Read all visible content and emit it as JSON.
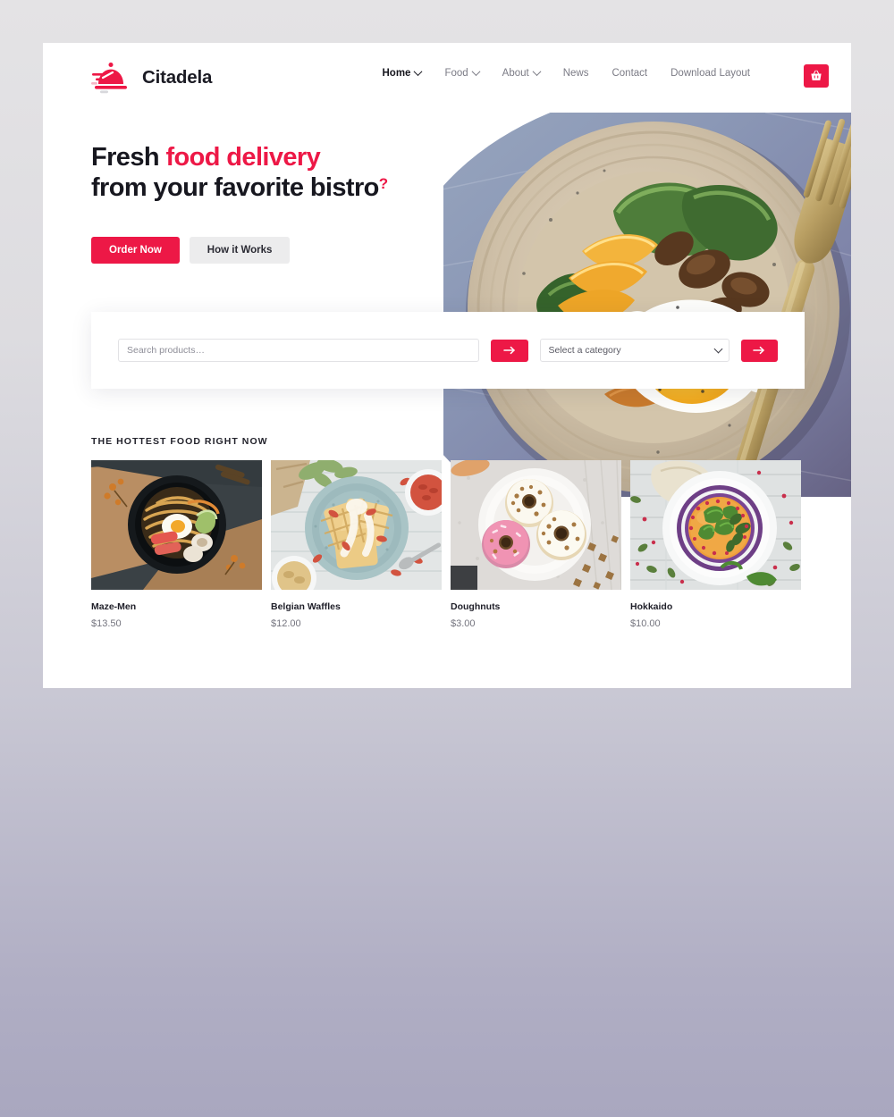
{
  "theme": {
    "accent": "#ed1846",
    "text_dark": "#17171f",
    "text_muted": "#7b7b85",
    "card_bg": "#ffffff",
    "page_bg_top": "#e4e3e5",
    "page_bg_bottom": "#a9a7bf"
  },
  "header": {
    "brand_name": "Citadela",
    "logo_icon": "service-bell-icon",
    "nav": [
      {
        "label": "Home",
        "has_dropdown": true,
        "active": true
      },
      {
        "label": "Food",
        "has_dropdown": true,
        "active": false
      },
      {
        "label": "About",
        "has_dropdown": true,
        "active": false
      },
      {
        "label": "News",
        "has_dropdown": false,
        "active": false
      },
      {
        "label": "Contact",
        "has_dropdown": false,
        "active": false
      },
      {
        "label": "Download Layout",
        "has_dropdown": false,
        "active": false
      }
    ],
    "cart_icon": "shopping-basket-icon"
  },
  "hero": {
    "title_part1": "Fresh ",
    "title_accent": "food delivery",
    "title_part2": "from your favorite bistro",
    "title_question": "?",
    "primary_button": "Order Now",
    "secondary_button": "How it Works",
    "image_alt": "plate-with-fried-egg-greens-mushrooms-and-gold-fork"
  },
  "search": {
    "placeholder": "Search products…",
    "value": "",
    "submit_icon": "arrow-right-icon",
    "category_selected": "Select a category",
    "category_submit_icon": "arrow-right-icon"
  },
  "products": {
    "heading": "THE HOTTEST FOOD RIGHT NOW",
    "items": [
      {
        "name": "Maze-Men",
        "price": "$13.50",
        "image_alt": "ramen-noodle-bowl"
      },
      {
        "name": "Belgian Waffles",
        "price": "$12.00",
        "image_alt": "waffles-on-teal-plate"
      },
      {
        "name": "Doughnuts",
        "price": "$3.00",
        "image_alt": "three-glazed-doughnuts"
      },
      {
        "name": "Hokkaido",
        "price": "$10.00",
        "image_alt": "pumpkin-soup-bowl"
      }
    ]
  }
}
